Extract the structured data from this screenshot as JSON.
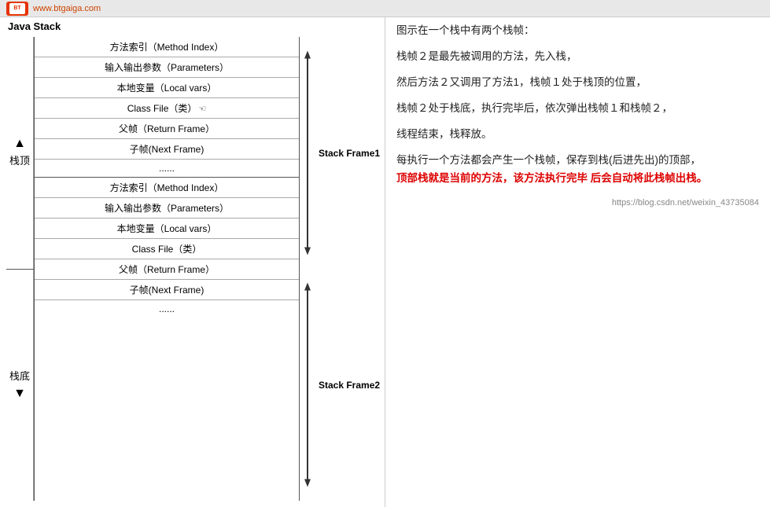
{
  "topbar": {
    "url": "www.btgaiga.com",
    "logo_text": "BT"
  },
  "diagram": {
    "title": "Java Stack",
    "left_top_label": "栈顶",
    "left_bottom_label": "栈底",
    "frame1_label": "Stack Frame1",
    "frame2_label": "Stack Frame2",
    "frame1_rows": [
      "方法索引（Method Index）",
      "输入输出参数（Parameters）",
      "本地变量（Local vars）",
      "Class File（类）",
      "父帧（Return Frame）",
      "子帧(Next Frame)",
      "......"
    ],
    "frame2_rows": [
      "方法索引（Method Index）",
      "输入输出参数（Parameters）",
      "本地变量（Local vars）",
      "Class File（类）",
      "父帧（Return Frame）",
      "子帧(Next Frame)",
      "......"
    ],
    "frame1_classfile_note": "Class File（类）",
    "frame1_cursor_row_index": 3
  },
  "text_panel": {
    "para1": "图示在一个栈中有两个栈帧：",
    "para2": "栈帧２是最先被调用的方法，先入栈，",
    "para3": "然后方法２又调用了方法1，栈帧１处于栈顶的位置，",
    "para4": "栈帧２处于栈底，执行完毕后，依次弹出栈帧１和栈帧２，",
    "para5": "线程结束，栈释放。",
    "para6_normal": "每执行一个方法都会产生一个栈帧，保存到栈(后进先出)的",
    "para6_top": "顶部，",
    "para6_red": "顶部栈就是当前的方法，该方法执行完毕 后会自动将此栈帧出栈。",
    "watermark": "https://blog.csdn.net/weixin_43735084"
  }
}
